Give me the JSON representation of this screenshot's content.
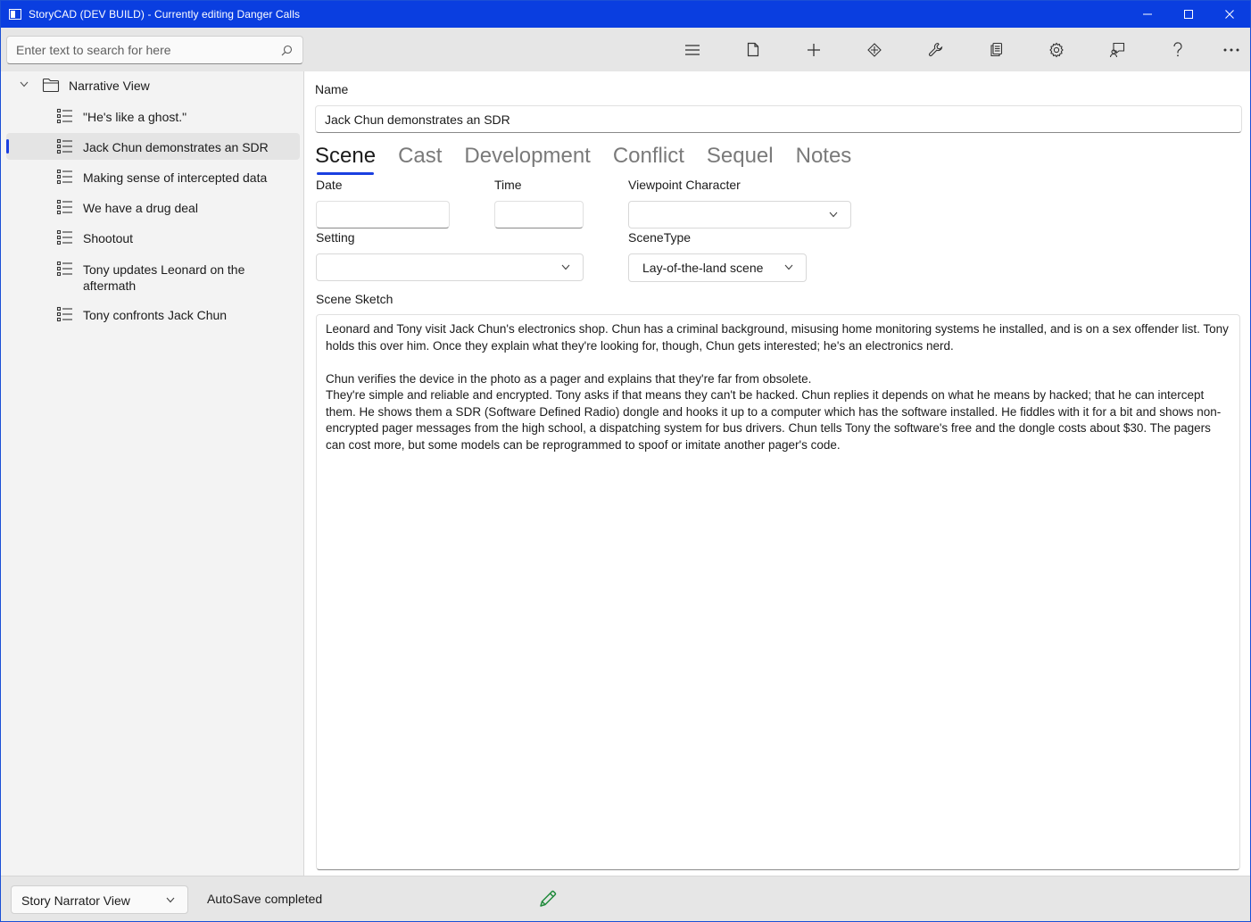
{
  "window": {
    "title": "StoryCAD (DEV BUILD) - Currently editing Danger Calls"
  },
  "search": {
    "placeholder": "Enter text to search for here"
  },
  "toolbar": {
    "icons": [
      "hamburger-menu-icon",
      "new-file-icon",
      "add-icon",
      "move-icon",
      "tools-icon",
      "reports-icon",
      "settings-icon",
      "feedback-icon",
      "help-icon",
      "more-icon"
    ]
  },
  "tree": {
    "root_label": "Narrative View",
    "items": [
      {
        "label": "\"He's like a ghost.\"",
        "selected": false
      },
      {
        "label": "Jack Chun demonstrates an SDR",
        "selected": true
      },
      {
        "label": "Making sense of intercepted data",
        "selected": false
      },
      {
        "label": "We have a drug deal",
        "selected": false
      },
      {
        "label": "Shootout",
        "selected": false
      },
      {
        "label": "Tony updates Leonard on the aftermath",
        "selected": false
      },
      {
        "label": "Tony confronts Jack Chun",
        "selected": false
      }
    ]
  },
  "form": {
    "name_label": "Name",
    "name_value": "Jack Chun demonstrates an SDR",
    "tabs": [
      "Scene",
      "Cast",
      "Development",
      "Conflict",
      "Sequel",
      "Notes"
    ],
    "active_tab": "Scene",
    "date_label": "Date",
    "date_value": "",
    "time_label": "Time",
    "time_value": "",
    "viewpoint_label": "Viewpoint Character",
    "viewpoint_value": "",
    "setting_label": "Setting",
    "setting_value": "",
    "scenetype_label": "SceneType",
    "scenetype_value": "Lay-of-the-land scene",
    "sketch_label": "Scene Sketch",
    "sketch_paragraphs": [
      "Leonard and Tony visit Jack Chun's electronics shop. Chun has a criminal background, misusing home monitoring systems he installed, and is on a sex offender list. Tony holds this over him. Once they explain what they're looking for, though, Chun gets interested; he's an electronics nerd.",
      "Chun verifies the device in the photo as a pager and explains that they're far from obsolete.",
      "They're simple and reliable and encrypted. Tony asks if that means they can't be hacked. Chun replies it depends on what he means by hacked; that he can intercept them. He shows them a SDR (Software Defined Radio) dongle and hooks it up to a computer which has the software installed. He fiddles with it for a bit and shows non-encrypted pager messages from the high school, a dispatching system for bus drivers. Chun tells Tony the software's free and the dongle costs about $30. The pagers can cost more, but some models can be reprogrammed to spoof or imitate another pager's code."
    ]
  },
  "status": {
    "view_mode": "Story Narrator View",
    "message": "AutoSave completed",
    "edit_icon_color": "#1f8a3a"
  },
  "colors": {
    "titlebar": "#0a3ee0",
    "accent": "#1a3fe0"
  }
}
